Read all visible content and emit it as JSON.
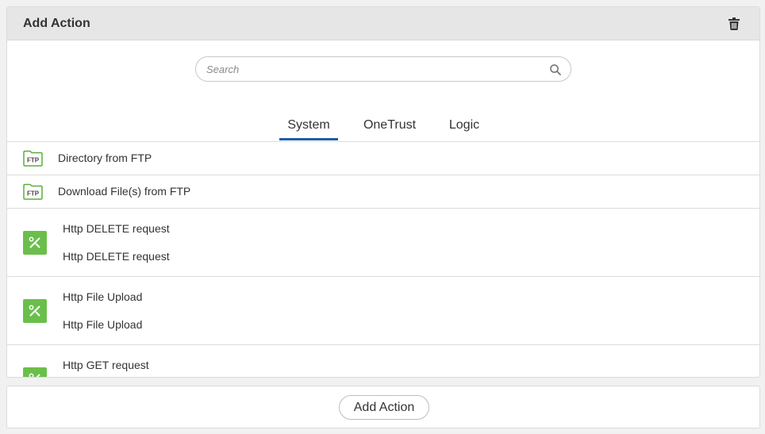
{
  "panel": {
    "title": "Add Action",
    "delete_icon": "trash-icon"
  },
  "search": {
    "placeholder": "Search",
    "value": "",
    "icon": "search-icon"
  },
  "tabs": [
    {
      "label": "System",
      "active": true
    },
    {
      "label": "OneTrust",
      "active": false
    },
    {
      "label": "Logic",
      "active": false
    }
  ],
  "actions": [
    {
      "icon": "ftp-folder-icon",
      "icon_text": "FTP",
      "label": "Directory from FTP"
    },
    {
      "icon": "ftp-folder-icon",
      "icon_text": "FTP",
      "label": "Download File(s) from FTP"
    },
    {
      "icon": "http-tools-icon",
      "label": "Http DELETE request",
      "description": "Http DELETE request"
    },
    {
      "icon": "http-tools-icon",
      "label": "Http File Upload",
      "description": "Http File Upload"
    },
    {
      "icon": "http-tools-icon",
      "label": "Http GET request",
      "description": ""
    }
  ],
  "footer": {
    "add_button_label": "Add Action"
  },
  "colors": {
    "accent_tab": "#1f5ea8",
    "icon_green": "#6abf4b",
    "header_bg": "#e6e6e6"
  }
}
